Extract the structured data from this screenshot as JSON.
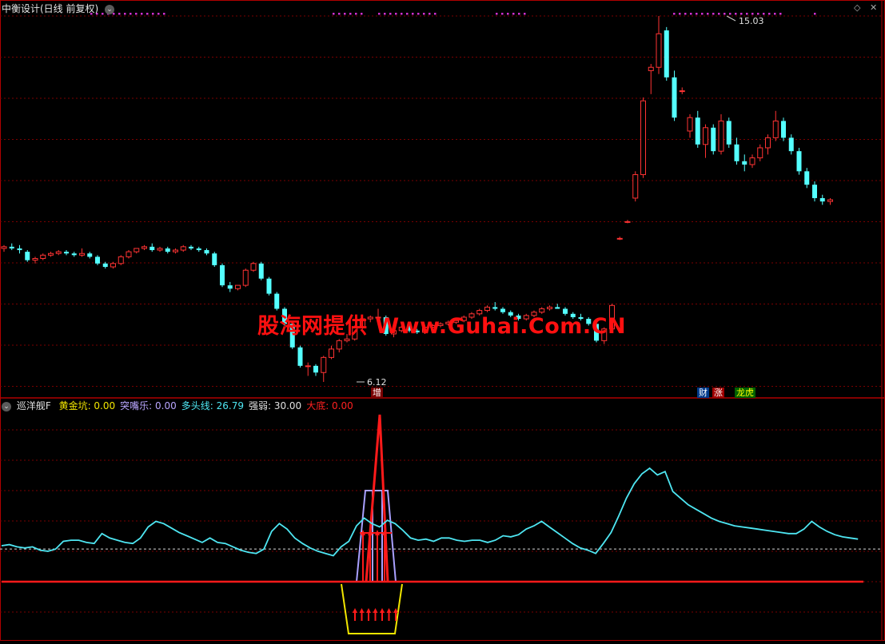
{
  "top_panel": {
    "title": "中衡设计(日线 前复权)",
    "high_label": "15.03",
    "low_label": "6.12",
    "marker_zeng": "增",
    "tags": {
      "cai": "财",
      "zhang": "涨",
      "longhu": "龙虎"
    }
  },
  "indicator_panel": {
    "name": "巡洋舰F",
    "items": [
      {
        "label": "黄金坑:",
        "value": "0.00",
        "color": "#f2e600"
      },
      {
        "label": "突嘴乐:",
        "value": "0.00",
        "color": "#b9a6ff"
      },
      {
        "label": "多头线:",
        "value": "26.79",
        "color": "#4ee6f2"
      },
      {
        "label": "强弱:",
        "value": "30.00",
        "color": "#e0e0e0"
      },
      {
        "label": "大底:",
        "value": "0.00",
        "color": "#ff2020"
      }
    ]
  },
  "watermark": "股海网提供 Www.Guhai.Com.CN",
  "corner_icons": {
    "diamond": "diamond-icon",
    "close": "close-icon"
  },
  "colors": {
    "up": "#ff3333",
    "down": "#54ffff",
    "grid": "#7a0000",
    "cyan_line": "#4ee6f2",
    "red_line": "#ff1a1a",
    "lavender": "#a9a0ff",
    "yellow": "#f2e600",
    "magenta": "#d030d0"
  },
  "chart_data": [
    {
      "type": "candlestick",
      "title": "中衡设计(日线 前复权)",
      "annotations": [
        "15.03",
        "6.12"
      ],
      "ohlc": [
        [
          8.1,
          8.2,
          8.0,
          8.15
        ],
        [
          8.15,
          8.25,
          8.05,
          8.1
        ],
        [
          8.1,
          8.2,
          7.95,
          8.05
        ],
        [
          8.0,
          8.05,
          7.7,
          7.75
        ],
        [
          7.75,
          7.85,
          7.65,
          7.8
        ],
        [
          7.8,
          7.95,
          7.75,
          7.9
        ],
        [
          7.9,
          8.0,
          7.85,
          7.95
        ],
        [
          7.95,
          8.05,
          7.9,
          8.0
        ],
        [
          8.0,
          8.05,
          7.9,
          7.95
        ],
        [
          7.95,
          8.0,
          7.85,
          7.9
        ],
        [
          7.9,
          8.1,
          7.85,
          7.95
        ],
        [
          7.95,
          8.0,
          7.8,
          7.85
        ],
        [
          7.85,
          7.9,
          7.6,
          7.65
        ],
        [
          7.65,
          7.7,
          7.5,
          7.55
        ],
        [
          7.55,
          7.7,
          7.5,
          7.65
        ],
        [
          7.65,
          7.9,
          7.6,
          7.85
        ],
        [
          7.85,
          8.05,
          7.8,
          8.0
        ],
        [
          8.0,
          8.1,
          7.95,
          8.1
        ],
        [
          8.1,
          8.2,
          8.05,
          8.15
        ],
        [
          8.15,
          8.25,
          8.0,
          8.05
        ],
        [
          8.05,
          8.15,
          8.0,
          8.1
        ],
        [
          8.1,
          8.15,
          7.95,
          8.0
        ],
        [
          8.0,
          8.1,
          7.95,
          8.05
        ],
        [
          8.05,
          8.2,
          8.0,
          8.15
        ],
        [
          8.15,
          8.2,
          8.05,
          8.1
        ],
        [
          8.1,
          8.15,
          8.0,
          8.05
        ],
        [
          8.05,
          8.1,
          7.9,
          7.95
        ],
        [
          7.95,
          8.0,
          7.55,
          7.6
        ],
        [
          7.6,
          7.65,
          6.95,
          7.0
        ],
        [
          7.0,
          7.1,
          6.8,
          6.9
        ],
        [
          6.9,
          7.0,
          6.85,
          7.0
        ],
        [
          7.0,
          7.5,
          6.95,
          7.45
        ],
        [
          7.45,
          7.7,
          7.4,
          7.65
        ],
        [
          7.65,
          7.7,
          7.15,
          7.2
        ],
        [
          7.2,
          7.25,
          6.7,
          6.75
        ],
        [
          6.75,
          6.8,
          6.25,
          6.3
        ],
        [
          6.3,
          6.35,
          5.8,
          5.85
        ],
        [
          5.85,
          5.9,
          5.1,
          5.15
        ],
        [
          5.15,
          5.2,
          4.55,
          4.6
        ],
        [
          4.6,
          4.7,
          4.3,
          4.6
        ],
        [
          4.6,
          4.65,
          4.3,
          4.4
        ],
        [
          4.4,
          4.9,
          4.12,
          4.85
        ],
        [
          4.85,
          5.2,
          4.8,
          5.1
        ],
        [
          5.1,
          5.4,
          5.0,
          5.35
        ],
        [
          5.35,
          5.55,
          5.3,
          5.4
        ],
        [
          5.4,
          5.8,
          5.35,
          5.75
        ],
        [
          5.75,
          6.05,
          5.7,
          6.0
        ],
        [
          6.0,
          6.1,
          5.9,
          6.05
        ],
        [
          6.05,
          6.3,
          6.0,
          6.05
        ],
        [
          6.05,
          6.1,
          5.5,
          5.55
        ],
        [
          5.55,
          5.7,
          5.45,
          5.65
        ],
        [
          5.65,
          5.8,
          5.6,
          5.75
        ],
        [
          5.75,
          5.8,
          5.6,
          5.65
        ],
        [
          5.65,
          5.7,
          5.55,
          5.6
        ],
        [
          5.6,
          5.8,
          5.55,
          5.75
        ],
        [
          5.75,
          5.85,
          5.7,
          5.8
        ],
        [
          5.8,
          5.9,
          5.75,
          5.85
        ],
        [
          5.85,
          5.95,
          5.8,
          5.9
        ],
        [
          5.9,
          6.0,
          5.85,
          5.95
        ],
        [
          5.95,
          6.1,
          5.9,
          6.05
        ],
        [
          6.05,
          6.2,
          6.0,
          6.15
        ],
        [
          6.15,
          6.3,
          6.1,
          6.25
        ],
        [
          6.25,
          6.4,
          6.2,
          6.35
        ],
        [
          6.35,
          6.5,
          6.25,
          6.3
        ],
        [
          6.3,
          6.35,
          6.15,
          6.2
        ],
        [
          6.2,
          6.25,
          6.05,
          6.1
        ],
        [
          6.1,
          6.15,
          5.95,
          6.0
        ],
        [
          6.0,
          6.15,
          5.95,
          6.1
        ],
        [
          6.1,
          6.25,
          6.05,
          6.2
        ],
        [
          6.2,
          6.35,
          6.15,
          6.3
        ],
        [
          6.3,
          6.4,
          6.25,
          6.35
        ],
        [
          6.35,
          6.45,
          6.3,
          6.3
        ],
        [
          6.3,
          6.35,
          6.1,
          6.15
        ],
        [
          6.15,
          6.2,
          6.0,
          6.05
        ],
        [
          6.05,
          6.15,
          5.95,
          6.0
        ],
        [
          6.0,
          6.05,
          5.8,
          5.85
        ],
        [
          5.85,
          5.9,
          5.3,
          5.35
        ],
        [
          5.35,
          5.75,
          5.25,
          5.7
        ],
        [
          5.7,
          6.45,
          5.65,
          6.4
        ],
        [
          8.4,
          8.45,
          8.35,
          8.4
        ],
        [
          8.9,
          8.95,
          8.85,
          8.9
        ],
        [
          9.6,
          10.4,
          9.5,
          10.3
        ],
        [
          10.3,
          12.6,
          10.2,
          12.5
        ],
        [
          13.4,
          13.6,
          12.7,
          13.5
        ],
        [
          13.5,
          15.03,
          13.3,
          14.5
        ],
        [
          14.6,
          14.7,
          13.1,
          13.2
        ],
        [
          13.2,
          13.4,
          11.9,
          12.0
        ],
        [
          12.8,
          12.9,
          12.7,
          12.8
        ],
        [
          11.6,
          12.1,
          11.4,
          12.0
        ],
        [
          12.0,
          12.2,
          11.1,
          11.2
        ],
        [
          11.2,
          11.8,
          10.8,
          11.7
        ],
        [
          11.7,
          11.8,
          10.9,
          11.0
        ],
        [
          11.0,
          12.1,
          10.9,
          11.9
        ],
        [
          11.9,
          12.0,
          11.1,
          11.2
        ],
        [
          11.2,
          11.4,
          10.6,
          10.7
        ],
        [
          10.7,
          10.9,
          10.4,
          10.6
        ],
        [
          10.6,
          10.9,
          10.5,
          10.8
        ],
        [
          10.8,
          11.2,
          10.7,
          11.1
        ],
        [
          11.1,
          11.5,
          10.9,
          11.4
        ],
        [
          11.4,
          12.2,
          11.3,
          11.9
        ],
        [
          11.9,
          12.0,
          11.3,
          11.4
        ],
        [
          11.4,
          11.5,
          10.9,
          11.0
        ],
        [
          11.0,
          11.1,
          10.3,
          10.4
        ],
        [
          10.4,
          10.5,
          9.9,
          10.0
        ],
        [
          10.0,
          10.1,
          9.5,
          9.6
        ],
        [
          9.6,
          9.7,
          9.4,
          9.5
        ],
        [
          9.5,
          9.6,
          9.4,
          9.55
        ]
      ]
    },
    {
      "type": "line",
      "title": "巡洋舰F",
      "series": [
        {
          "name": "黄金坑",
          "values": []
        },
        {
          "name": "突嘴乐",
          "values": []
        },
        {
          "name": "多头线",
          "values": []
        },
        {
          "name": "强弱",
          "values": []
        },
        {
          "name": "大底",
          "values": []
        }
      ],
      "ylim": [
        -50,
        155
      ],
      "reference_line": 30,
      "dmt_line": [
        33,
        34,
        32,
        31,
        32,
        29,
        28,
        30,
        37,
        38,
        38,
        36,
        35,
        44,
        40,
        38,
        36,
        35,
        40,
        50,
        55,
        53,
        49,
        45,
        42,
        39,
        36,
        40,
        36,
        35,
        32,
        29,
        27,
        26,
        30,
        46,
        53,
        48,
        40,
        35,
        31,
        28,
        26,
        24,
        32,
        37,
        51,
        58,
        53,
        50,
        56,
        53,
        47,
        40,
        38,
        39,
        37,
        40,
        40,
        38,
        37,
        38,
        38,
        36,
        38,
        42,
        41,
        43,
        48,
        51,
        55,
        50,
        45,
        40,
        35,
        31,
        29,
        26,
        35,
        45,
        60,
        76,
        89,
        98,
        103,
        97,
        100,
        82,
        76,
        70,
        66,
        62,
        58,
        55,
        53,
        51,
        50,
        49,
        48,
        47,
        46,
        45,
        44,
        44,
        48,
        55,
        50,
        46,
        43,
        41,
        40,
        39
      ],
      "spike_index": [
        37,
        41
      ]
    }
  ]
}
